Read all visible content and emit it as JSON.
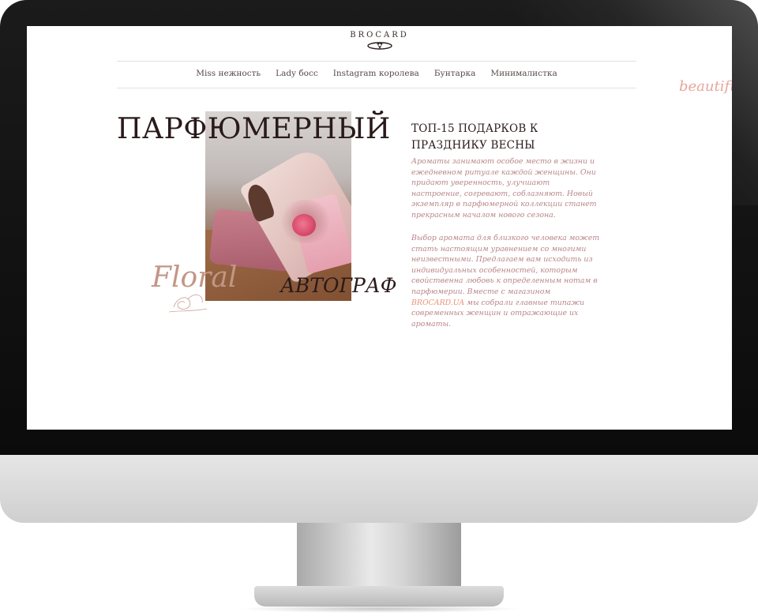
{
  "brand": {
    "name": "BROCARD"
  },
  "nav": {
    "items": [
      {
        "label": "Miss нежность"
      },
      {
        "label": "Lady босс"
      },
      {
        "label": "Instagram королева"
      },
      {
        "label": "Бунтарка"
      },
      {
        "label": "Минималистка"
      }
    ]
  },
  "deco": {
    "beautiful": "beautifu",
    "script": "Floral"
  },
  "hero": {
    "headline_top": "ПАРФЮМЕРНЫЙ",
    "headline_bottom": "АВТОГРАФ"
  },
  "article": {
    "title": "ТОП-15 ПОДАРКОВ К ПРАЗДНИКУ ВЕСНЫ",
    "paragraph1": "Ароматы занимают особое место в жизни и ежедневном ритуале каждой женщины. Они придают уверенность, улучшают настроение, согревают, соблазняют. Новый экземпляр в парфюмерной коллекции станет прекрасным началом нового сезона.",
    "paragraph2_before": "Выбор аромата для близкого человека может стать настоящим уравнением со многими неизвестными. Предлагаем вам исходить из индивидуальных особенностей, которым свойственна любовь к определенным нотам в парфюмерии. Вместе с магазином ",
    "paragraph2_link": "BROCARD.UA",
    "paragraph2_after": " мы собрали главные типажи современных женщин и отражающие их ароматы."
  },
  "colors": {
    "accent": "#e89378",
    "body_text": "#b9858a",
    "heading": "#2a1a1a"
  },
  "icons": [
    "brocard-crest-icon",
    "floral-sketch-icon"
  ]
}
